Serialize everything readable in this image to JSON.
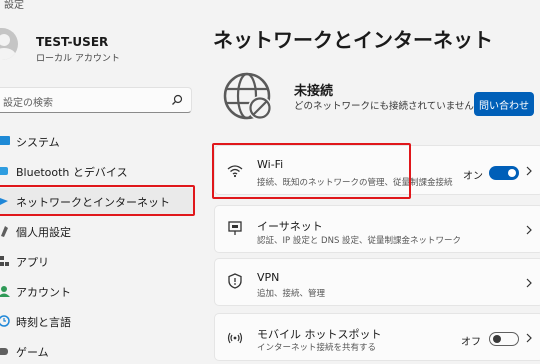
{
  "window": {
    "title": "設定"
  },
  "user": {
    "name": "TEST-USER",
    "account_type": "ローカル アカウント"
  },
  "search": {
    "placeholder": "設定の検索"
  },
  "sidebar": {
    "items": [
      {
        "label": "システム",
        "icon": "system-icon"
      },
      {
        "label": "Bluetooth とデバイス",
        "icon": "bluetooth-icon"
      },
      {
        "label": "ネットワークとインターネット",
        "icon": "network-icon",
        "active": true
      },
      {
        "label": "個人用設定",
        "icon": "personalization-icon"
      },
      {
        "label": "アプリ",
        "icon": "apps-icon"
      },
      {
        "label": "アカウント",
        "icon": "account-icon"
      },
      {
        "label": "時刻と言語",
        "icon": "time-language-icon"
      },
      {
        "label": "ゲーム",
        "icon": "gaming-icon"
      }
    ]
  },
  "main": {
    "title": "ネットワークとインターネット",
    "status": {
      "title": "未接続",
      "description": "どのネットワークにも接続されていません。",
      "contact_button": "問い合わせ"
    },
    "cards": [
      {
        "title": "Wi-Fi",
        "description": "接続、既知のネットワークの管理、従量制課金接続",
        "toggle_label": "オン",
        "toggle_on": true,
        "icon": "wifi-icon"
      },
      {
        "title": "イーサネット",
        "description": "認証、IP 設定と DNS 設定、従量制課金ネットワーク",
        "icon": "ethernet-icon"
      },
      {
        "title": "VPN",
        "description": "追加、接続、管理",
        "icon": "vpn-icon"
      },
      {
        "title": "モバイル ホットスポット",
        "description": "インターネット接続を共有する",
        "toggle_label": "オフ",
        "toggle_on": false,
        "icon": "hotspot-icon"
      }
    ]
  },
  "colors": {
    "accent": "#005fb8",
    "highlight_box": "#e0171b"
  }
}
